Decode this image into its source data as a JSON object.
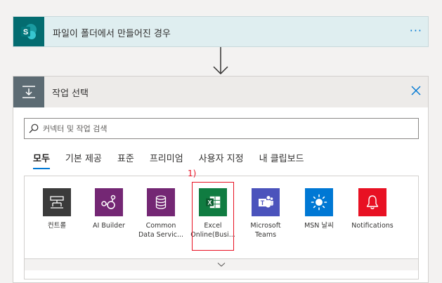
{
  "trigger": {
    "title": "파일이 폴더에서 만들어진 경우",
    "more_label": "···",
    "icon": "sharepoint-icon"
  },
  "action": {
    "title": "작업 선택",
    "icon": "action-icon",
    "search_placeholder": "커넥터 및 작업 검색",
    "tabs": [
      {
        "label": "모두",
        "active": true
      },
      {
        "label": "기본 제공",
        "active": false
      },
      {
        "label": "표준",
        "active": false
      },
      {
        "label": "프리미엄",
        "active": false
      },
      {
        "label": "사용자 지정",
        "active": false
      },
      {
        "label": "내 클립보드",
        "active": false
      }
    ],
    "connectors": [
      {
        "label": "컨트롤",
        "icon": "control-icon",
        "color": "#3b3b3b"
      },
      {
        "label": "AI Builder",
        "icon": "ai-builder-icon",
        "color": "#742774"
      },
      {
        "label": "Common\nData Servic...",
        "icon": "database-icon",
        "color": "#742774"
      },
      {
        "label": "Excel\nOnline(Busi...",
        "icon": "excel-icon",
        "color": "#107c41"
      },
      {
        "label": "Microsoft\nTeams",
        "icon": "teams-icon",
        "color": "#4b53bc"
      },
      {
        "label": "MSN 날씨",
        "icon": "weather-icon",
        "color": "#0078d4"
      },
      {
        "label": "Notifications",
        "icon": "bell-icon",
        "color": "#e81123"
      }
    ],
    "annotation": "1)"
  }
}
